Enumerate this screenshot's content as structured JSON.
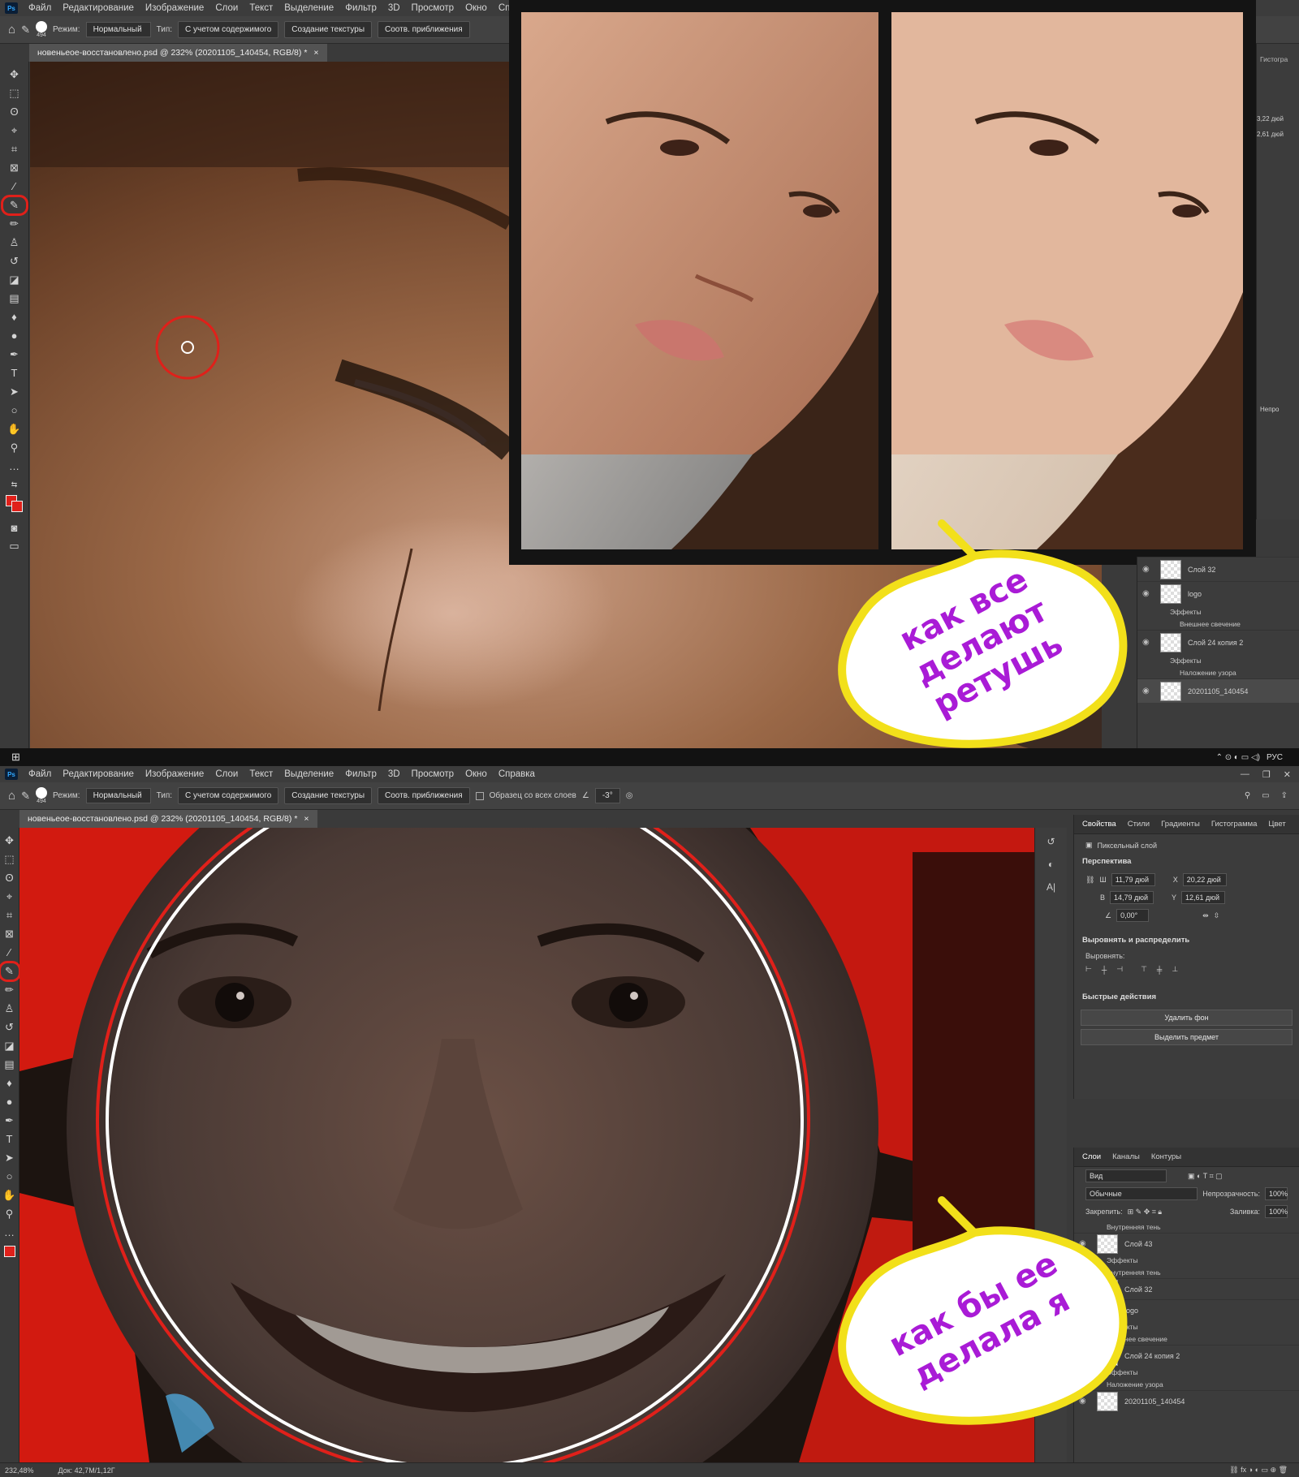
{
  "menu": [
    "Файл",
    "Редактирование",
    "Изображение",
    "Слои",
    "Текст",
    "Выделение",
    "Фильтр",
    "3D",
    "Просмотр",
    "Окно",
    "Справка"
  ],
  "top": {
    "options": {
      "brush_size": "494",
      "mode_label": "Режим:",
      "mode_value": "Нормальный",
      "type_label": "Тип:",
      "type_opts": [
        "С учетом содержимого",
        "Создание текстуры",
        "Соотв. приближения"
      ]
    },
    "tab": "новеньеое-восстановлено.psd @ 232% (20201105_140454, RGB/8) *",
    "right_fragments": {
      "tab": "Гистогра",
      "w": "3,22 дюй",
      "h": "2,61 дюй",
      "opacity": "Непро"
    },
    "layers": [
      {
        "name": "Слой 32"
      },
      {
        "name": "logo",
        "effects_label": "Эффекты",
        "effect": "Внешнее свечение"
      },
      {
        "name": "Слой 24 копия 2",
        "effects_label": "Эффекты",
        "effect": "Наложение узора"
      },
      {
        "name": "20201105_140454"
      }
    ],
    "taskbar": {
      "lang": "РУС"
    },
    "bubble": [
      "как все",
      "делают",
      "ретушь"
    ]
  },
  "bottom": {
    "options": {
      "brush_size": "494",
      "mode_label": "Режим:",
      "mode_value": "Нормальный",
      "type_label": "Тип:",
      "type_opts": [
        "С учетом содержимого",
        "Создание текстуры",
        "Соотв. приближения"
      ],
      "sample_all": "Образец со всех слоев",
      "angle": "-3°"
    },
    "tab": "новеньеое-восстановлено.psd @ 232% (20201105_140454, RGB/8) *",
    "properties": {
      "tabs": [
        "Свойства",
        "Стили",
        "Градиенты",
        "Гистограмма",
        "Цвет"
      ],
      "layer_type": "Пиксельный слой",
      "perspective": "Перспектива",
      "w_label": "Ш",
      "w": "11,79 дюй",
      "x_label": "X",
      "x": "20,22 дюй",
      "h_label": "В",
      "h": "14,79 дюй",
      "y_label": "Y",
      "y": "12,61 дюй",
      "angle": "0,00°",
      "align_title": "Выровнять и распределить",
      "align_label": "Выровнять:",
      "quick_title": "Быстрые действия",
      "btn_remove_bg": "Удалить фон",
      "btn_select_subject": "Выделить предмет"
    },
    "layers_panel": {
      "tabs": [
        "Слои",
        "Каналы",
        "Контуры"
      ],
      "filter": "Вид",
      "blend": "Обычные",
      "opacity_label": "Непрозрачность:",
      "opacity": "100%",
      "lock_label": "Закрепить:",
      "fill_label": "Заливка:",
      "fill": "100%",
      "items": [
        {
          "name": "Внутренняя тень",
          "kind": "effect"
        },
        {
          "name": "Слой 43",
          "kind": "layer"
        },
        {
          "name": "Эффекты",
          "kind": "effect"
        },
        {
          "name": "Внутренняя тень",
          "kind": "effect"
        },
        {
          "name": "Слой 32",
          "kind": "layer"
        },
        {
          "name": "logo",
          "kind": "layer"
        },
        {
          "name": "Эффекты",
          "kind": "effect"
        },
        {
          "name": "Внешнее свечение",
          "kind": "effect"
        },
        {
          "name": "Слой 24 копия 2",
          "kind": "layer"
        },
        {
          "name": "Эффекты",
          "kind": "effect"
        },
        {
          "name": "Наложение узора",
          "kind": "effect"
        },
        {
          "name": "20201105_140454",
          "kind": "layer"
        }
      ]
    },
    "status": {
      "zoom": "232,48%",
      "doc": "Док: 42,7M/1,12Г"
    },
    "bubble": [
      "как бы ее",
      "делала я"
    ]
  },
  "colors": {
    "accent_red": "#e0201a",
    "bubble_yellow": "#f2e01a",
    "bubble_text": "#a91bd6"
  }
}
